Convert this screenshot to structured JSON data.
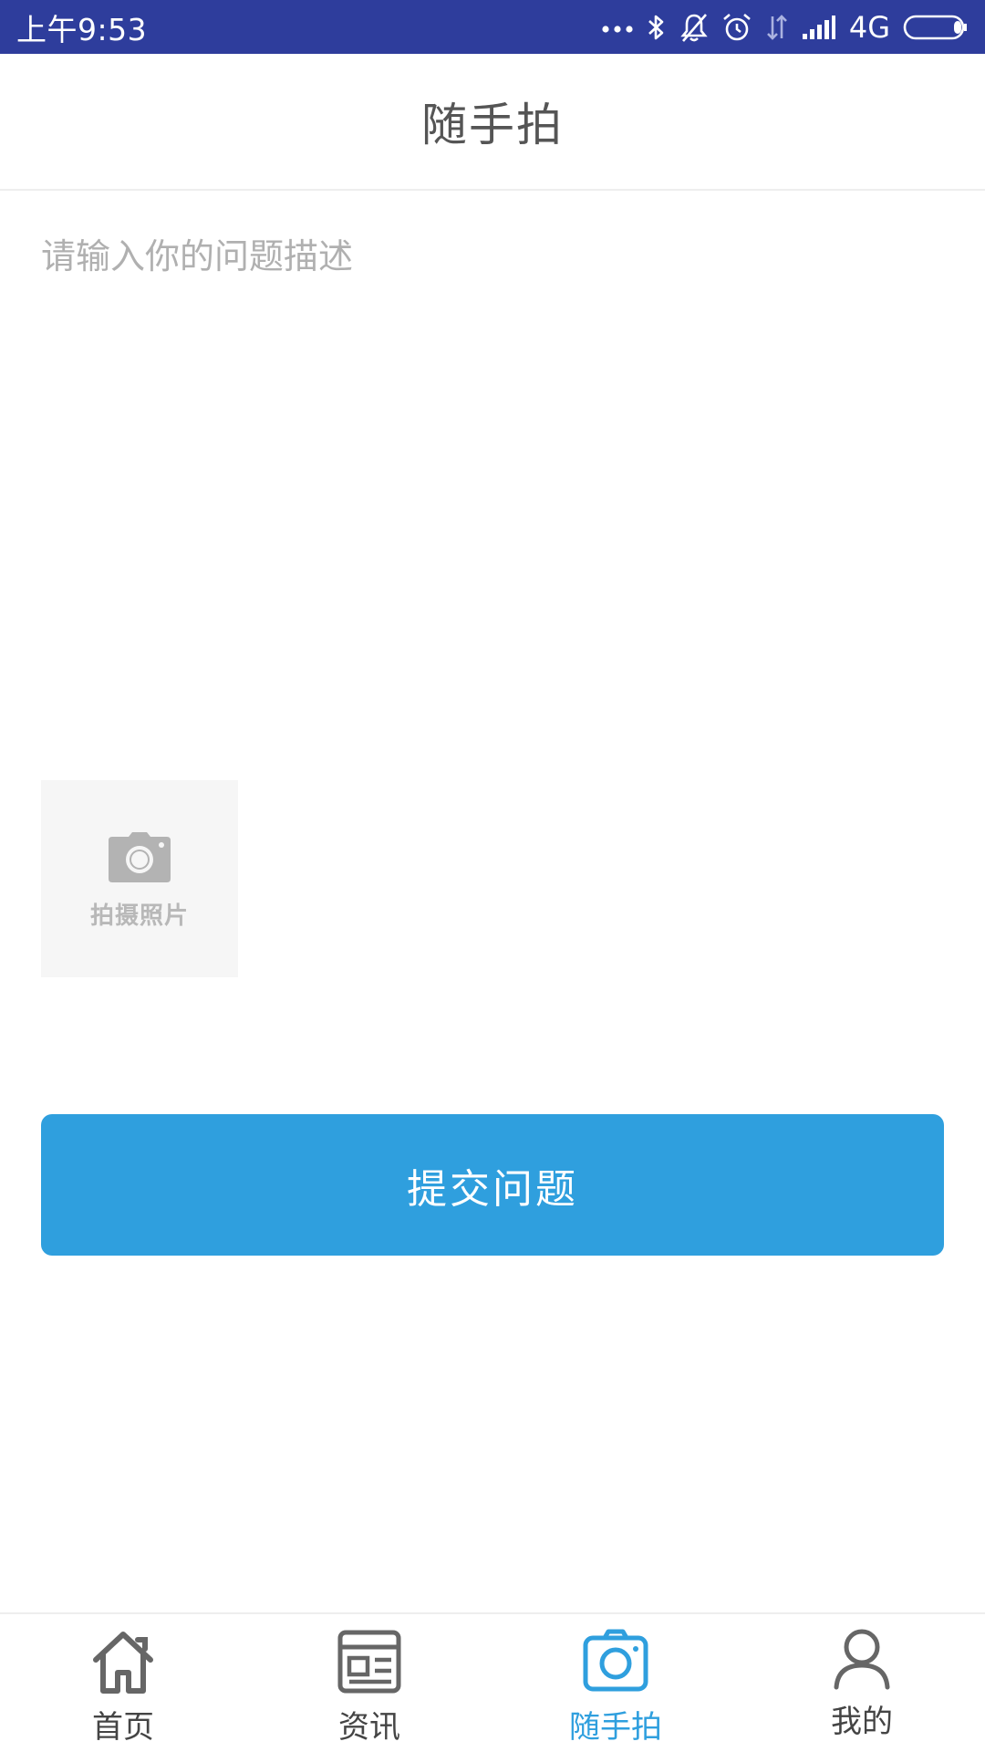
{
  "status_bar": {
    "time": "上午9:53",
    "network": "4G",
    "icons": [
      "more-dots-icon",
      "bluetooth-icon",
      "mute-bell-icon",
      "alarm-icon",
      "data-arrows-icon",
      "signal-icon",
      "battery-icon"
    ]
  },
  "header": {
    "title": "随手拍"
  },
  "form": {
    "description_placeholder": "请输入你的问题描述",
    "description_value": "",
    "photo_label": "拍摄照片",
    "photo_icon": "camera-icon",
    "submit_label": "提交问题"
  },
  "bottom_nav": {
    "items": [
      {
        "label": "首页",
        "icon": "home-icon",
        "active": false
      },
      {
        "label": "资讯",
        "icon": "news-icon",
        "active": false
      },
      {
        "label": "随手拍",
        "icon": "camera-icon",
        "active": true
      },
      {
        "label": "我的",
        "icon": "user-icon",
        "active": false
      }
    ]
  },
  "colors": {
    "status_bar": "#2e3d9c",
    "accent": "#2f9fde",
    "title_text": "#555555",
    "placeholder": "#b0b0b0",
    "tile_bg": "#f6f6f6",
    "nav_inactive": "#444444"
  }
}
